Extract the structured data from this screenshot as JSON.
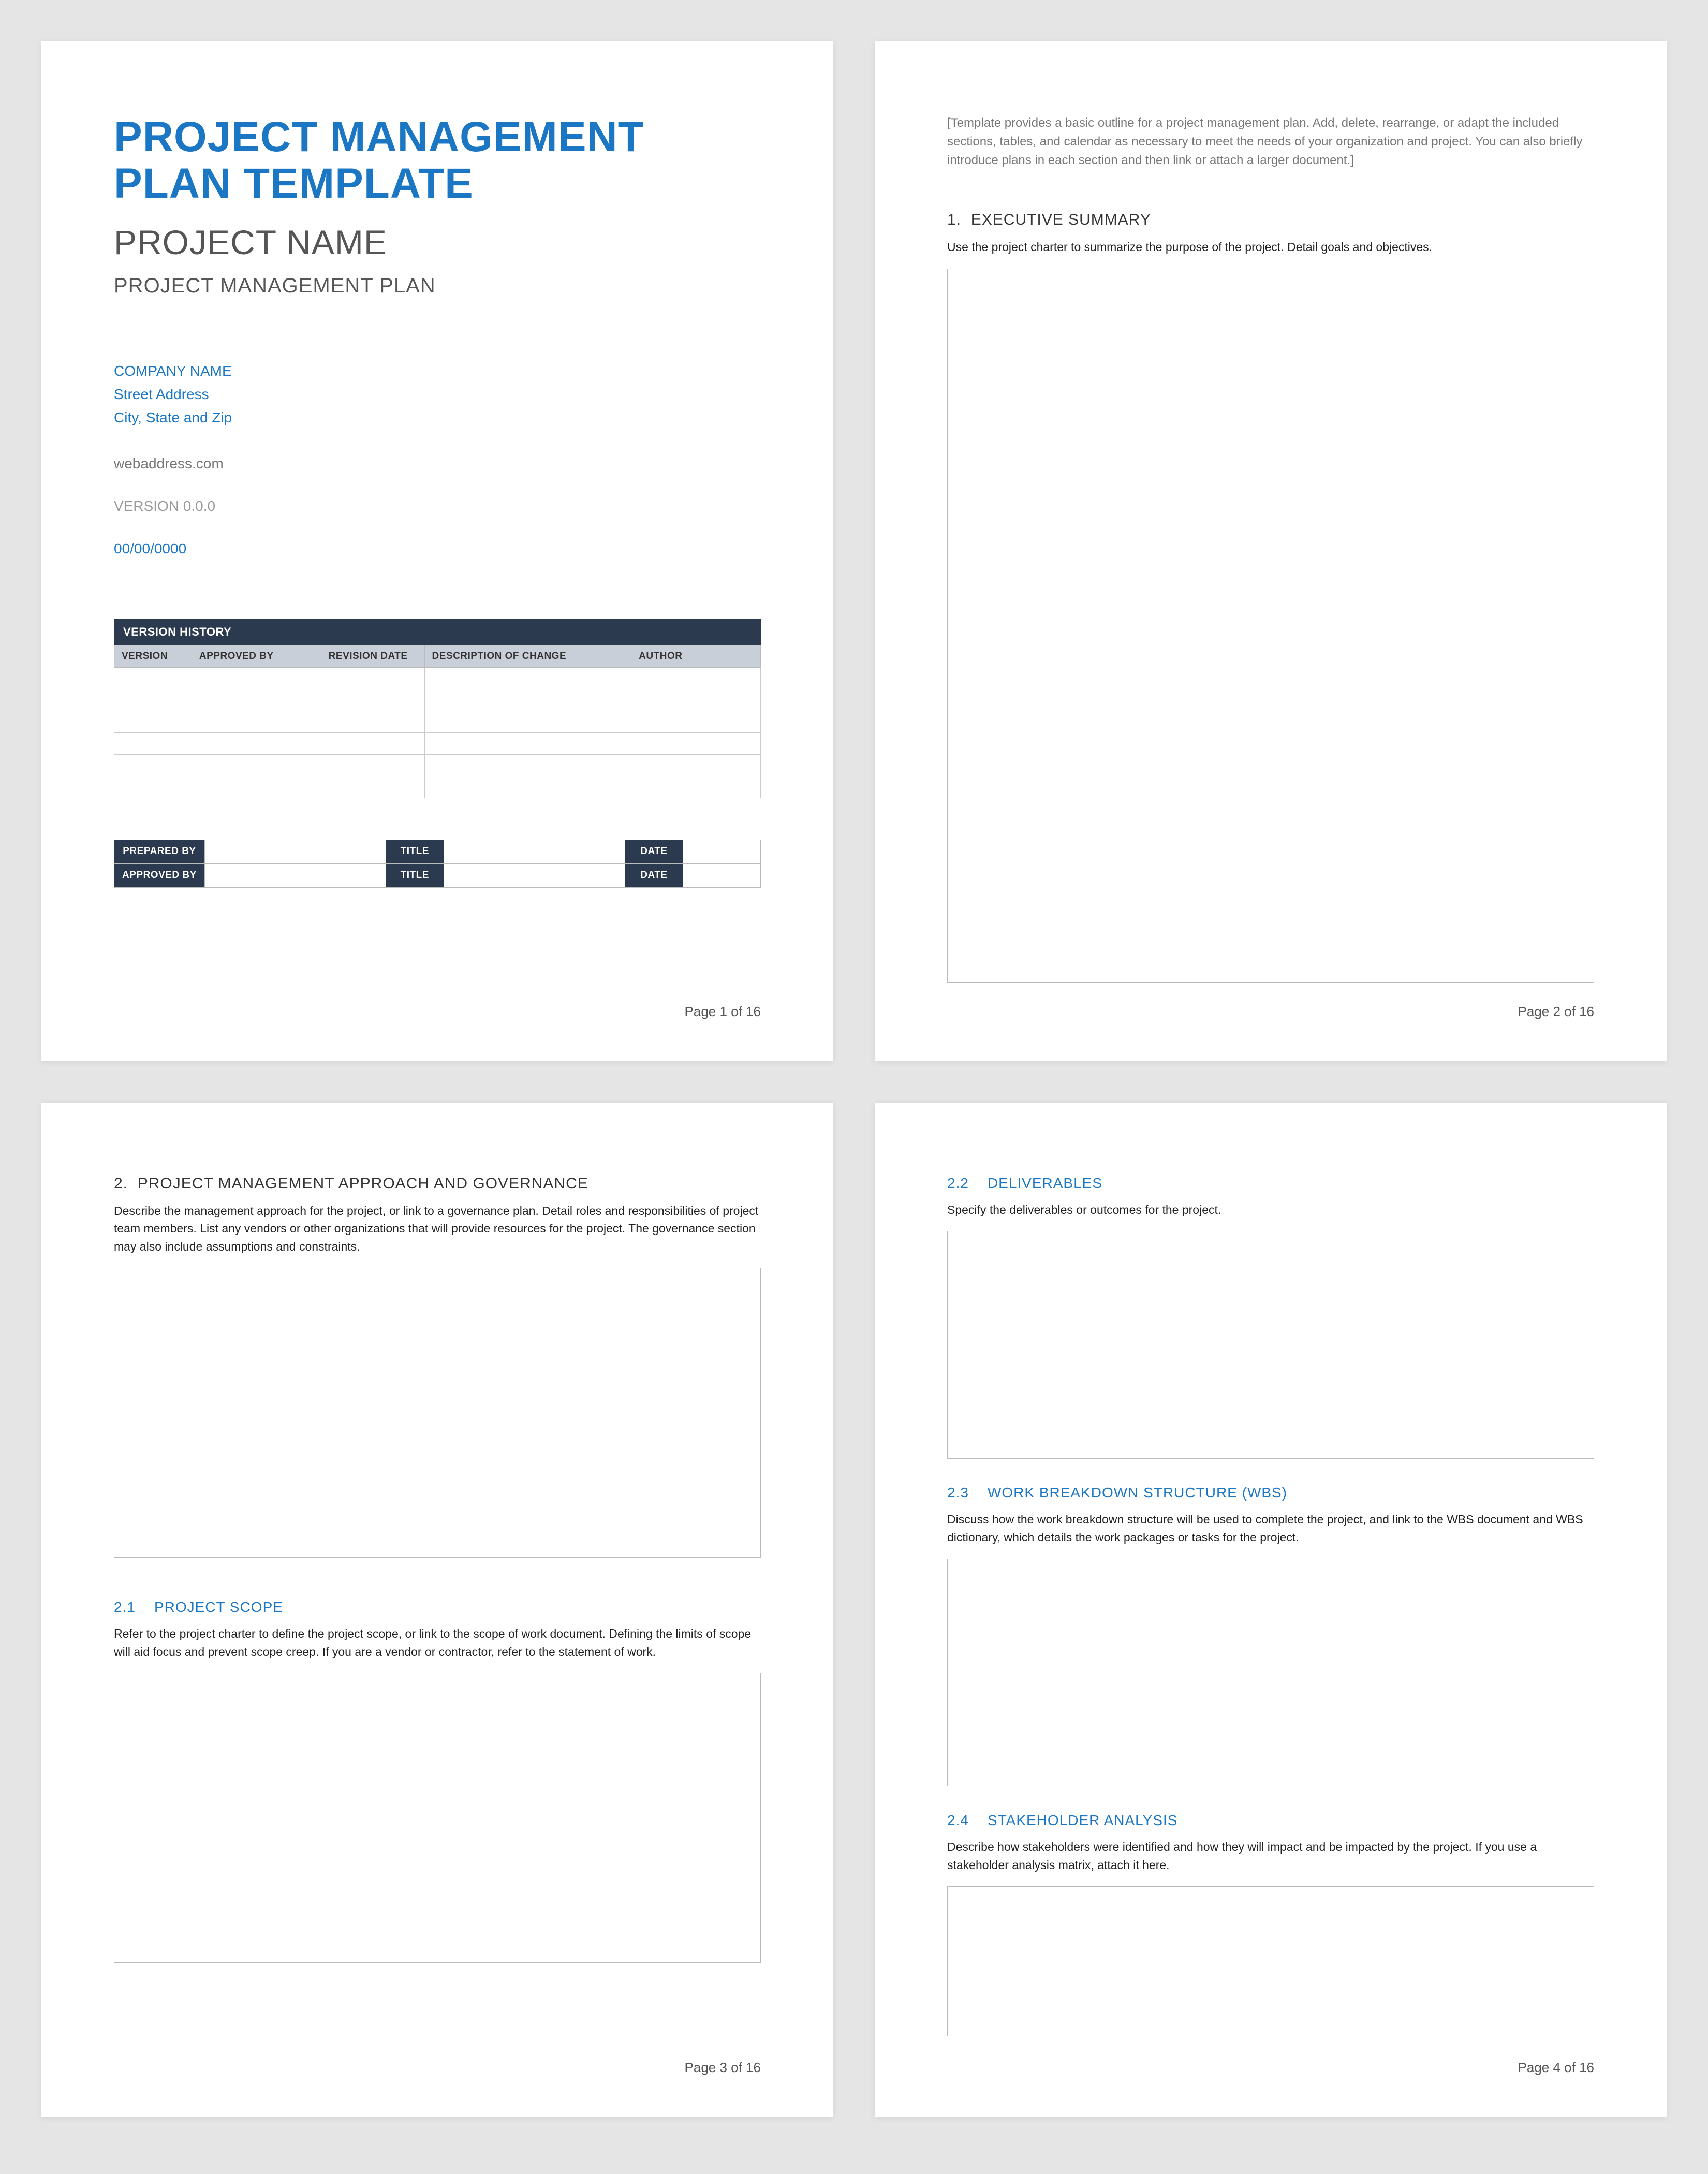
{
  "doc_title": "PROJECT MANAGEMENT PLAN TEMPLATE",
  "project_name": "PROJECT NAME",
  "plan_label": "PROJECT MANAGEMENT PLAN",
  "company": {
    "name": "COMPANY NAME",
    "street": "Street Address",
    "city": "City, State and Zip"
  },
  "web": "webaddress.com",
  "version": "VERSION 0.0.0",
  "date": "00/00/0000",
  "version_history": {
    "title": "VERSION HISTORY",
    "headers": [
      "VERSION",
      "APPROVED BY",
      "REVISION DATE",
      "DESCRIPTION OF CHANGE",
      "AUTHOR"
    ],
    "row_count": 6
  },
  "signoff": {
    "rows": [
      {
        "label1": "PREPARED BY",
        "val1": "",
        "label2": "TITLE",
        "val2": "",
        "label3": "DATE",
        "val3": ""
      },
      {
        "label1": "APPROVED BY",
        "val1": "",
        "label2": "TITLE",
        "val2": "",
        "label3": "DATE",
        "val3": ""
      }
    ]
  },
  "intro_note": "[Template provides a basic outline for a project management plan. Add, delete, rearrange, or adapt the included sections, tables, and calendar as necessary to meet the needs of your organization and project. You can also briefly introduce plans in each section and then link or attach a larger document.]",
  "sections": {
    "s1": {
      "num": "1.",
      "title": "EXECUTIVE SUMMARY",
      "desc": "Use the project charter to summarize the purpose of the project. Detail goals and objectives."
    },
    "s2": {
      "num": "2.",
      "title": "PROJECT MANAGEMENT APPROACH AND GOVERNANCE",
      "desc": "Describe the management approach for the project, or link to a governance plan. Detail roles and responsibilities of project team members. List any vendors or other organizations that will provide resources for the project. The governance section may also include assumptions and constraints."
    },
    "s2_1": {
      "num": "2.1",
      "title": "PROJECT SCOPE",
      "desc": "Refer to the project charter to define the project scope, or link to the scope of work document. Defining the limits of scope will aid focus and prevent scope creep. If you are a vendor or contractor, refer to the statement of work."
    },
    "s2_2": {
      "num": "2.2",
      "title": "DELIVERABLES",
      "desc": "Specify the deliverables or outcomes for the project."
    },
    "s2_3": {
      "num": "2.3",
      "title": "WORK BREAKDOWN STRUCTURE (WBS)",
      "desc": "Discuss how the work breakdown structure will be used to complete the project, and link to the WBS document and WBS dictionary, which details the work packages or tasks for the project."
    },
    "s2_4": {
      "num": "2.4",
      "title": "STAKEHOLDER ANALYSIS",
      "desc": "Describe how stakeholders were identified and how they will impact and be impacted by the project. If you use a stakeholder analysis matrix, attach it here."
    }
  },
  "pages": {
    "p1": "Page 1 of 16",
    "p2": "Page 2 of 16",
    "p3": "Page 3 of 16",
    "p4": "Page 4 of 16"
  }
}
